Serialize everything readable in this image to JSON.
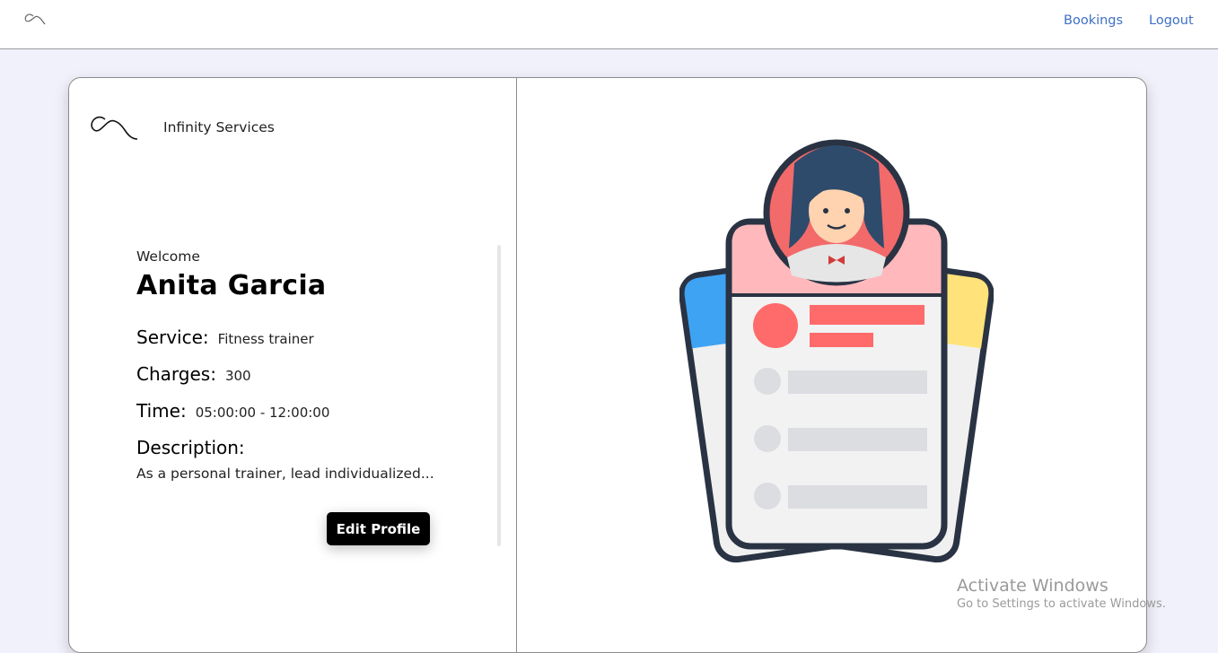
{
  "nav": {
    "logo_icon": "infinity-wave-icon",
    "links": [
      "Bookings",
      "Logout"
    ],
    "link_color": "#3f6fc4"
  },
  "brand": {
    "name": "Infinity Services",
    "logo_icon": "infinity-wave-icon"
  },
  "profile": {
    "welcome": "Welcome",
    "name": "Anita Garcia",
    "service_label": "Service:",
    "service_value": "Fitness trainer",
    "charges_label": "Charges:",
    "charges_value": "300",
    "time_label": "Time:",
    "time_value": "05:00:00 - 12:00:00",
    "description_label": "Description:",
    "description_value": "As a personal trainer, lead individualized...",
    "edit_button": "Edit Profile"
  },
  "illustration": {
    "icon": "profile-cards-illustration"
  },
  "watermark": {
    "title": "Activate Windows",
    "subtitle": "Go to Settings to activate Windows."
  },
  "colors": {
    "page_bg": "#f1f1fb",
    "button_bg": "#000000",
    "accent_red": "#ff6b6b"
  }
}
